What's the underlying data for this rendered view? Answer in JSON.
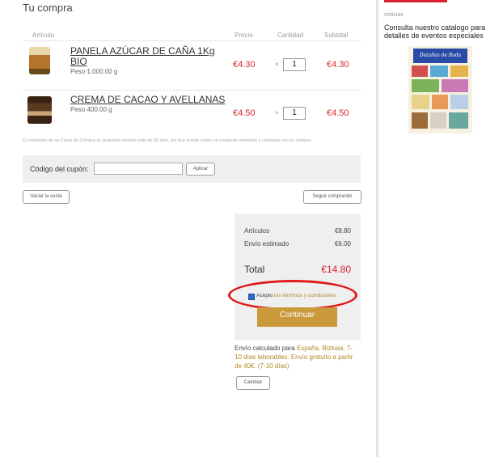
{
  "cart": {
    "title": "Tu compra",
    "columns": {
      "article": "Artículo",
      "price": "Precio",
      "quantity": "Cantidad",
      "subtotal": "Subtotal"
    },
    "items": [
      {
        "name_line1": "PANELA AZÚCAR DE CAÑA 1Kg",
        "name_line2": "BIO",
        "weight": "Peso 1.000.00 g",
        "price": "€4.30",
        "qty_prefix": "×",
        "qty": "1",
        "subtotal": "€4.30"
      },
      {
        "name_line1": "CREMA DE CACAO Y AVELLANAS",
        "name_line2": "",
        "weight": "Peso 400.00 g",
        "price": "€4.50",
        "qty_prefix": "×",
        "qty": "1",
        "subtotal": "€4.50"
      }
    ],
    "note": "El contenido de su Cesta de Compra se guardará durante más de 30 días, así que puede volver en cualquier momento y continuar con su compra."
  },
  "coupon": {
    "label": "Código del cupón:",
    "input_value": "",
    "apply_label": "Aplicar"
  },
  "actions": {
    "empty_cart": "Vaciar la cesta",
    "continue_shopping": "Seguir comprando"
  },
  "summary": {
    "articles_label": "Artículos",
    "articles_value": "€8.80",
    "shipping_label": "Envío estimado",
    "shipping_value": "€6.00",
    "total_label": "Total",
    "total_value": "€14.80",
    "terms_prefix": "Acepto ",
    "terms_link": "los términos y condiciones",
    "terms_checked": true,
    "continue_label": "Continuar"
  },
  "shipping": {
    "prefix": "Envío calculado para ",
    "detail": "España, Bizkaia, 7-10 días laborables. Envío gratuito a partir de 40€. (7-10 días)",
    "change_label": "Cambiar"
  },
  "sidebar": {
    "heading": "noticias",
    "catalog_text": "Consulta nuestro catalogo para detalles de eventos especiales",
    "catalog_banner_text": "Detalles de Boda"
  },
  "colors": {
    "accent_red": "#d9232e",
    "gold": "#c9993b",
    "highlight_ellipse": "#e0191b",
    "checkbox": "#2d6ac9"
  }
}
